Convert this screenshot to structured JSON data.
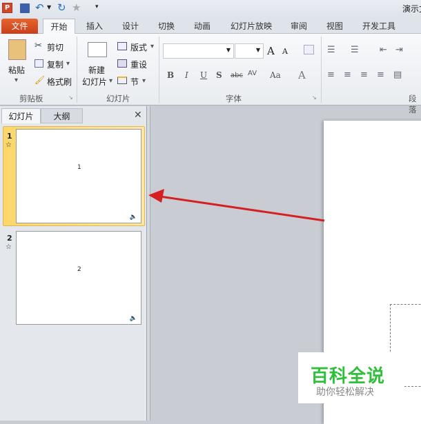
{
  "title_bar": {
    "title": "演示文"
  },
  "ribbon_tabs": [
    "文件",
    "开始",
    "插入",
    "设计",
    "切换",
    "动画",
    "幻灯片放映",
    "审阅",
    "视图",
    "开发工具"
  ],
  "clipboard": {
    "paste": "粘贴",
    "cut": "剪切",
    "copy": "复制",
    "format_painter": "格式刷",
    "label": "剪贴板"
  },
  "slides_group": {
    "new_slide_1": "新建",
    "new_slide_2": "幻灯片",
    "layout": "版式",
    "reset": "重设",
    "section": "节",
    "label": "幻灯片"
  },
  "font_group": {
    "bold": "B",
    "italic": "I",
    "underline": "U",
    "shadow": "S",
    "strike": "abc",
    "spacing": "AV",
    "case": "Aa",
    "color": "A",
    "grow": "A",
    "shrink": "A",
    "label": "字体"
  },
  "paragraph_group": {
    "label": "段落"
  },
  "panel": {
    "tab_slides": "幻灯片",
    "tab_outline": "大纲",
    "close": "✕"
  },
  "slides": [
    {
      "number": "1",
      "content": "1"
    },
    {
      "number": "2",
      "content": "2"
    }
  ],
  "watermark": {
    "title": "百科全说",
    "subtitle": "助你轻松解决"
  },
  "colors": {
    "file_tab": "#d9542a",
    "selection": "#fbd66a",
    "arrow": "#d42020",
    "watermark": "#2fbf3a"
  }
}
